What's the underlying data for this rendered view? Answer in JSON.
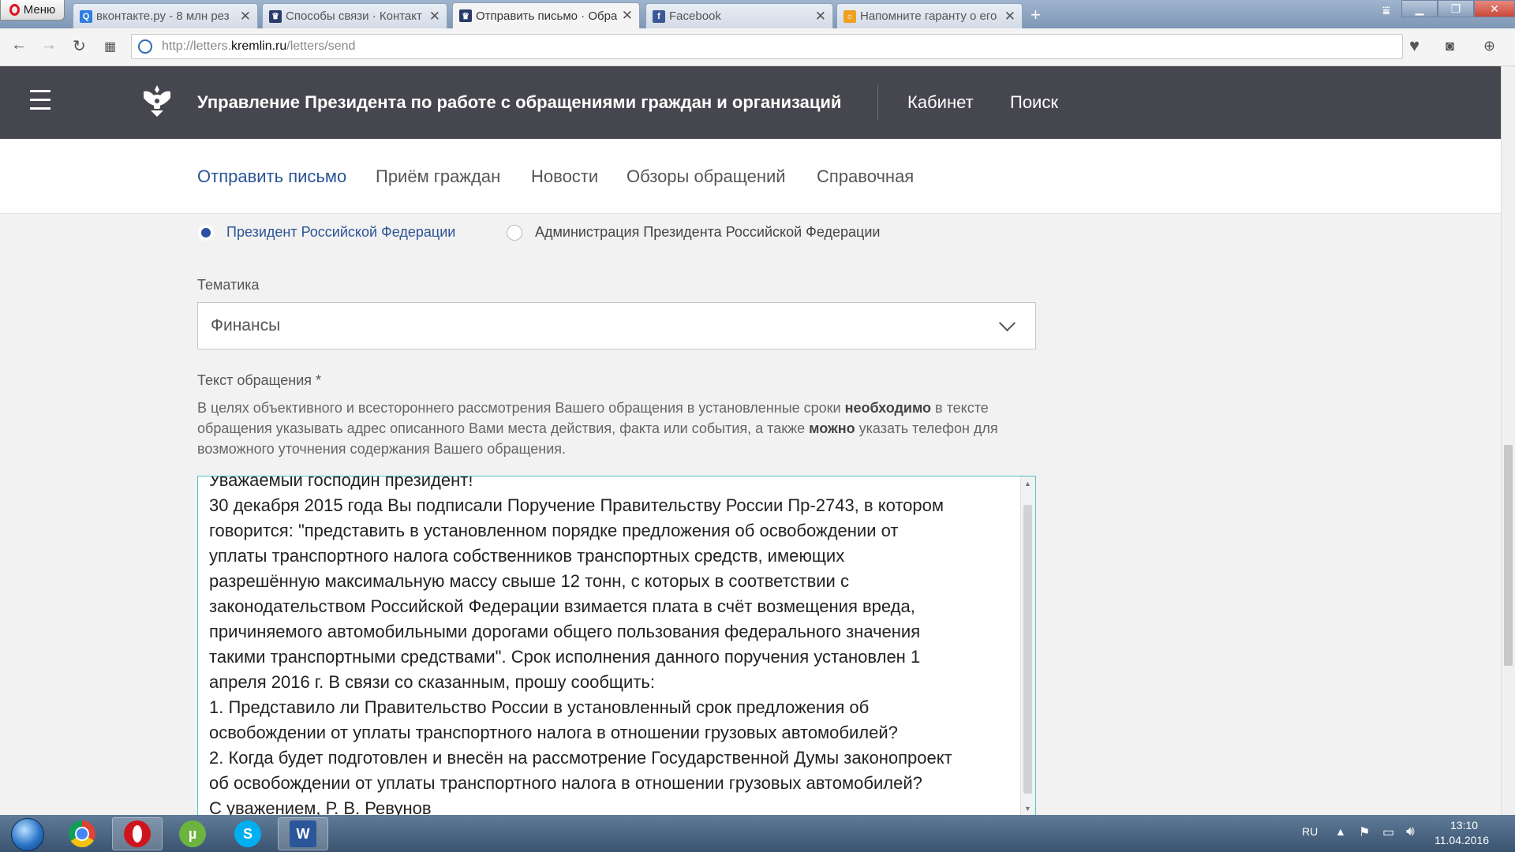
{
  "browser": {
    "menu_label": "Меню",
    "tabs": [
      {
        "label": "вконтакте.ру - 8 млн рез",
        "icon": "search-favicon-icon"
      },
      {
        "label": "Способы связи · Контакт",
        "icon": "kremlin-favicon-icon"
      },
      {
        "label": "Отправить письмо · Обра",
        "icon": "kremlin-favicon-icon"
      },
      {
        "label": "Facebook",
        "icon": "facebook-favicon-icon"
      },
      {
        "label": "Напомните гаранту о его",
        "icon": "sun-favicon-icon"
      }
    ],
    "url_scheme": "http://letters.",
    "url_host": "kremlin.ru",
    "url_path": "/letters/send"
  },
  "header": {
    "title": "Управление Президента по работе с обращениями граждан и организаций",
    "links": [
      "Кабинет",
      "Поиск"
    ]
  },
  "subnav": {
    "items": [
      "Отправить письмо",
      "Приём граждан",
      "Новости",
      "Обзоры обращений",
      "Справочная"
    ],
    "active_index": 0
  },
  "form": {
    "recipients": [
      {
        "label": "Президент Российской Федерации",
        "selected": true
      },
      {
        "label": "Администрация Президента Российской Федерации",
        "selected": false
      }
    ],
    "topic_label": "Тематика",
    "topic_value": "Финансы",
    "text_label": "Текст обращения *",
    "hint_1": "В целях объективного и всестороннего рассмотрения Вашего обращения в установленные сроки ",
    "hint_bold_1": "необходимо",
    "hint_2": " в тексте обращения указывать адрес описанного Вами места действия, факта или события, а также ",
    "hint_bold_2": "можно",
    "hint_3": " указать телефон для возможного уточнения содержания Вашего обращения.",
    "letter_text": "Уважаемый господин президент!\n30 декабря 2015 года Вы подписали Поручение Правительству России Пр-2743, в котором\nговорится: \"представить в установленном порядке предложения об освобождении от\nуплаты транспортного налога собственников транспортных средств, имеющих\nразрешённую максимальную массу свыше 12 тонн, с которых в соответствии с\nзаконодательством Российской Федерации взимается плата в счёт возмещения вреда,\nпричиняемого автомобильными дорогами общего пользования федерального значения\nтакими транспортными средствами\". Срок исполнения данного поручения установлен 1\nапреля 2016 г. В связи со сказанным, прошу сообщить:\n1. Представило ли Правительство России в установленный срок предложения об\nосвобождении от уплаты транспортного налога в отношении грузовых автомобилей?\n2. Когда будет подготовлен и внесён на рассмотрение Государственной Думы законопроект\nоб освобождении от уплаты транспортного налога в отношении грузовых автомобилей?\nС уважением, Р. В. Ревунов"
  },
  "taskbar": {
    "apps": [
      "chrome",
      "opera",
      "utorrent",
      "skype",
      "word"
    ],
    "language": "RU",
    "time": "13:10",
    "date": "11.04.2016"
  },
  "colors": {
    "header_bg": "#46464e",
    "accent_blue": "#2b5496",
    "textarea_border": "#55c1c1"
  }
}
